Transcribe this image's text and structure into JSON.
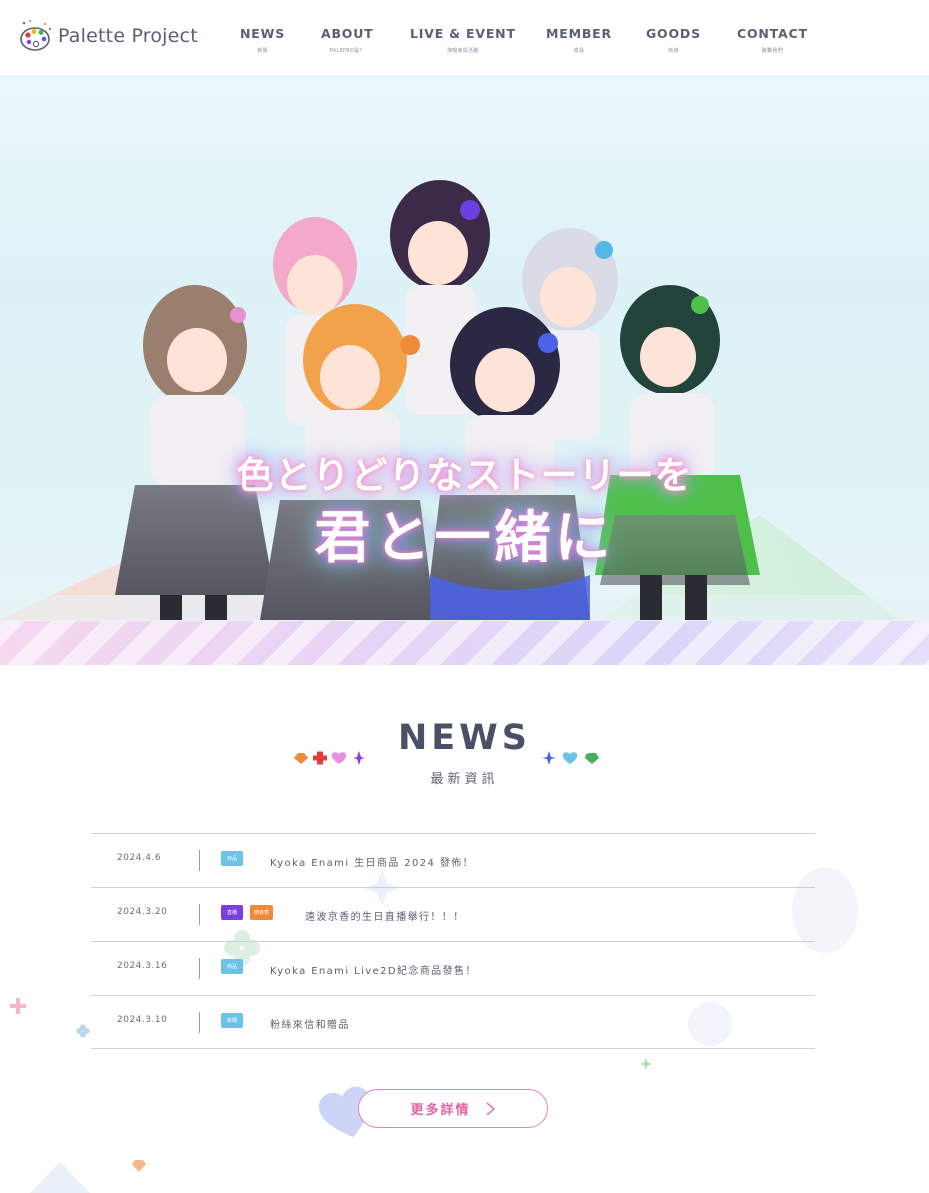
{
  "brand": {
    "name": "Palette Project"
  },
  "nav": [
    {
      "label": "NEWS",
      "sub": "新聞"
    },
    {
      "label": "ABOUT",
      "sub": "PALEPRO是？"
    },
    {
      "label": "LIVE & EVENT",
      "sub": "演唱會與活動"
    },
    {
      "label": "MEMBER",
      "sub": "成員"
    },
    {
      "label": "GOODS",
      "sub": "商城"
    },
    {
      "label": "CONTACT",
      "sub": "聯繫我們"
    }
  ],
  "hero": {
    "catch_line1": "色とりどりなストーリーを",
    "catch_line2": "君と一緒に"
  },
  "news": {
    "title": "NEWS",
    "subtitle": "最新資訊",
    "items": [
      {
        "date": "2024.4.6",
        "tags": [
          {
            "label": "商品",
            "color": "#6cc3e8"
          }
        ],
        "text": "Kyoka Enami 生日商品 2024 發佈！"
      },
      {
        "date": "2024.3.20",
        "tags": [
          {
            "label": "直播",
            "color": "#7b3fe0"
          },
          {
            "label": "節目表",
            "color": "#ee8a3c"
          }
        ],
        "text": "遠波京香的生日直播舉行！！！"
      },
      {
        "date": "2024.3.16",
        "tags": [
          {
            "label": "商品",
            "color": "#6cc3e8"
          }
        ],
        "text": "Kyoka Enami Live2D紀念商品發售！"
      },
      {
        "date": "2024.3.10",
        "tags": [
          {
            "label": "新聞",
            "color": "#6cc3e8"
          }
        ],
        "text": "粉絲來信和贈品"
      }
    ],
    "more_label": "更多詳情"
  },
  "colors": {
    "accent_pink": "#e066a6",
    "text_dark": "#4c5066",
    "deco_orange": "#f08a3b",
    "deco_red": "#e83a3a",
    "deco_pink": "#e88fe6",
    "deco_purple": "#8a3fe0",
    "deco_blue": "#4a63e8",
    "deco_lightblue": "#6cc3e8",
    "deco_green": "#44b05a"
  },
  "icons": {
    "logo": "palette-logo-icon",
    "more_arrow": "chevron-right-icon"
  }
}
